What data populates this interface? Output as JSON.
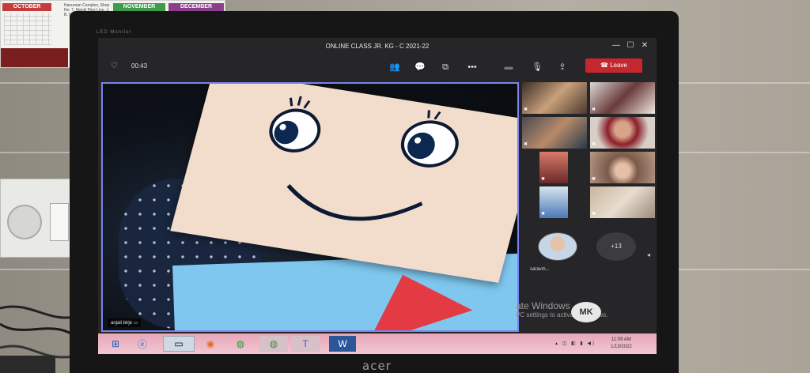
{
  "calendar": {
    "months": [
      "OCTOBER",
      "NOVEMBER",
      "DECEMBER"
    ],
    "shop_text": "Hanuman Complex, Shop No. 7, Maroli Pipe Line, J. B. Nagar"
  },
  "monitor": {
    "led_label": "LED Monitor",
    "brand": "acer"
  },
  "teams": {
    "window_title": "ONLINE CLASS JR. KG - C 2021-22",
    "timer": "00:43",
    "leave_label": "Leave",
    "main_participant": "anjali birje",
    "avatar_name": "saravm...",
    "more_participants": "+13",
    "mk_initials": "MK",
    "watermark_line1": "ate Windows",
    "watermark_line2": "PC settings to activate Windows."
  },
  "taskbar": {
    "time": "11:09 AM",
    "date": "1/13/2022"
  },
  "colors": {
    "leave": "#c4272e",
    "active_speaker": "#7b83eb",
    "taskbar": "#e7a7b9"
  }
}
